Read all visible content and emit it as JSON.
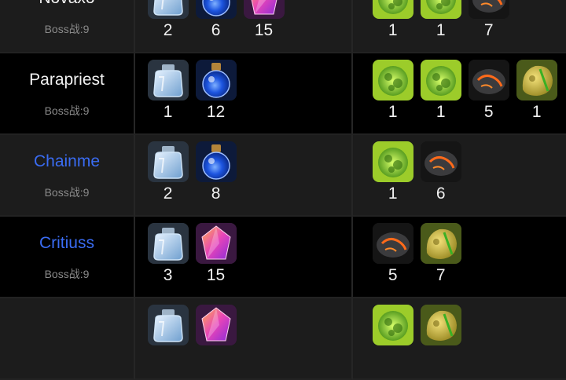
{
  "rows": [
    {
      "name": "Novaxo",
      "boss": "Boss战:9",
      "consumables": [
        {
          "icon": "empty-flask-icon",
          "count": "2"
        },
        {
          "icon": "blue-potion-icon",
          "count": "6"
        },
        {
          "icon": "pink-crystal-icon",
          "count": "15"
        }
      ],
      "drops": [
        {
          "icon": "green-ore-icon",
          "count": "1"
        },
        {
          "icon": "green-ore-icon",
          "count": "1"
        },
        {
          "icon": "lava-rock-icon",
          "count": "7"
        }
      ]
    },
    {
      "name": "Parapriest",
      "boss": "Boss战:9",
      "consumables": [
        {
          "icon": "empty-flask-icon",
          "count": "1"
        },
        {
          "icon": "blue-potion-icon",
          "count": "12"
        }
      ],
      "drops": [
        {
          "icon": "green-ore-icon",
          "count": "1"
        },
        {
          "icon": "green-ore-icon",
          "count": "1"
        },
        {
          "icon": "lava-rock-icon",
          "count": "5"
        },
        {
          "icon": "gold-ore-icon",
          "count": "1"
        }
      ]
    },
    {
      "name": "Chainme",
      "boss": "Boss战:9",
      "consumables": [
        {
          "icon": "empty-flask-icon",
          "count": "2"
        },
        {
          "icon": "blue-potion-icon",
          "count": "8"
        }
      ],
      "drops": [
        {
          "icon": "green-ore-icon",
          "count": "1"
        },
        {
          "icon": "lava-rock-icon",
          "count": "6"
        }
      ]
    },
    {
      "name": "Critiuss",
      "boss": "Boss战:9",
      "consumables": [
        {
          "icon": "empty-flask-icon",
          "count": "3"
        },
        {
          "icon": "pink-crystal-icon",
          "count": "15"
        }
      ],
      "drops": [
        {
          "icon": "lava-rock-icon",
          "count": "5"
        },
        {
          "icon": "gold-ore-icon",
          "count": "7"
        }
      ]
    },
    {
      "name": "",
      "boss": "",
      "consumables": [
        {
          "icon": "empty-flask-icon",
          "count": ""
        },
        {
          "icon": "pink-crystal-icon",
          "count": ""
        }
      ],
      "drops": [
        {
          "icon": "green-ore-icon",
          "count": ""
        },
        {
          "icon": "gold-ore-icon",
          "count": ""
        }
      ]
    }
  ],
  "colors": {
    "name_white": "#f2f2f2",
    "name_blue": "#3a6cf2",
    "boss_gray": "#8a8a8a"
  }
}
